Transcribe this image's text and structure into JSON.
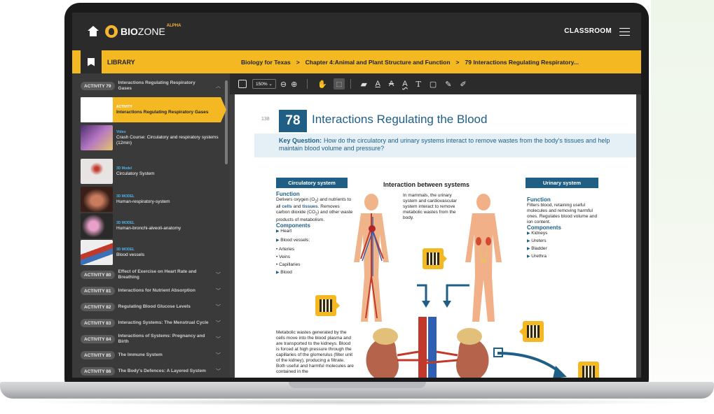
{
  "topbar": {
    "logo_bold": "BIO",
    "logo_light": "ZONE",
    "logo_tag": "ALPHA",
    "classroom": "CLASSROOM"
  },
  "library": {
    "label": "LIBRARY",
    "breadcrumb": [
      "Biology for Texas",
      "Chapter 4:Animal and Plant Structure and Function",
      "79 Interactions Regulating Respiratory..."
    ],
    "separator": ">"
  },
  "sidebar": {
    "activity_79": {
      "badge": "ACTIVITY 79",
      "title": "Interactions Regulating Respiratory Gases"
    },
    "resources": [
      {
        "type": "ACTIVITY",
        "title": "Interactions Regulating Respiratory Gases",
        "thumb_color": "#ffffff"
      },
      {
        "type": "Video",
        "title": "Crash Course: Circulatory and respiratory systems (12min)",
        "thumb_color": "#7a4f8e"
      },
      {
        "type": "3D Model",
        "title": "Circulatory System",
        "thumb_color": "#e9e4e4"
      },
      {
        "type": "3D MODEL",
        "title": "Human-respiratory-system",
        "thumb_color": "#8a4a3a"
      },
      {
        "type": "3D MODEL",
        "title": "Human-bronchi-alveoli-anatomy",
        "thumb_color": "#b85d8a"
      },
      {
        "type": "3D MODEL",
        "title": "Blood vessels",
        "thumb_color": "#d9d9d9"
      }
    ],
    "activities": [
      {
        "badge": "ACTIVITY 80",
        "title": "Effect of Exercise on Heart Rate and Breathing"
      },
      {
        "badge": "ACTIVITY 81",
        "title": "Interactions for Nutrient Absorption"
      },
      {
        "badge": "ACTIVITY 82",
        "title": "Regulating Blood Glucose Levels"
      },
      {
        "badge": "ACTIVITY 83",
        "title": "Interacting Systems: The Menstrual Cycle"
      },
      {
        "badge": "ACTIVITY 84",
        "title": "Interactions of Systems: Pregnancy and Birth"
      },
      {
        "badge": "ACTIVITY 85",
        "title": "The Immune System"
      },
      {
        "badge": "ACTIVITY 86",
        "title": "The Body's Defences: A Layered System"
      }
    ]
  },
  "toolbar": {
    "zoom": "150%"
  },
  "page": {
    "number": "138",
    "chapter_num": "78",
    "title": "Interactions Regulating the Blood",
    "key_question_label": "Key Question:",
    "key_question": "How do the circulatory and urinary systems interact to remove wastes from the body's tissues and help maintain blood volume and pressure?",
    "circulatory": {
      "header": "Circulatory system",
      "function_h": "Function",
      "function_text_1": "Delivers oxygen (O",
      "function_sub_1": "2",
      "function_text_2": ") and nutrients to all ",
      "cells": "cells",
      "and": " and ",
      "tissues": "tissues",
      "function_text_3": ". Removes carbon dioxide (CO",
      "function_sub_2": "2",
      "function_text_4": ") and other waste products of metabolism.",
      "components_h": "Components",
      "components": [
        "Heart",
        "Blood vessels:"
      ],
      "vessels": [
        "Arteries",
        "Veins",
        "Capillaries"
      ],
      "blood": "Blood"
    },
    "interaction_h": "Interaction between systems",
    "interaction_text": "In mammals, the urinary system and cardiovascular system interact to remove metabolic wastes from the body.",
    "urinary": {
      "header": "Urinary system",
      "function_h": "Function",
      "function_text": "Filters blood, retaining useful molecules and removing harmful ones. Regulates blood volume and ion content.",
      "components_h": "Components",
      "components": [
        "Kidneys",
        "Ureters",
        "Bladder",
        "Urethra"
      ]
    },
    "metabolic_text": "Metabolic wastes generated by the cells move into the blood plasma and are transported to the kidneys. Blood is forced at high pressure through the capillaries of the glomerulus (filter unit of the kidney), producing a filtrate. Both useful and harmful molecules are contained in the"
  }
}
